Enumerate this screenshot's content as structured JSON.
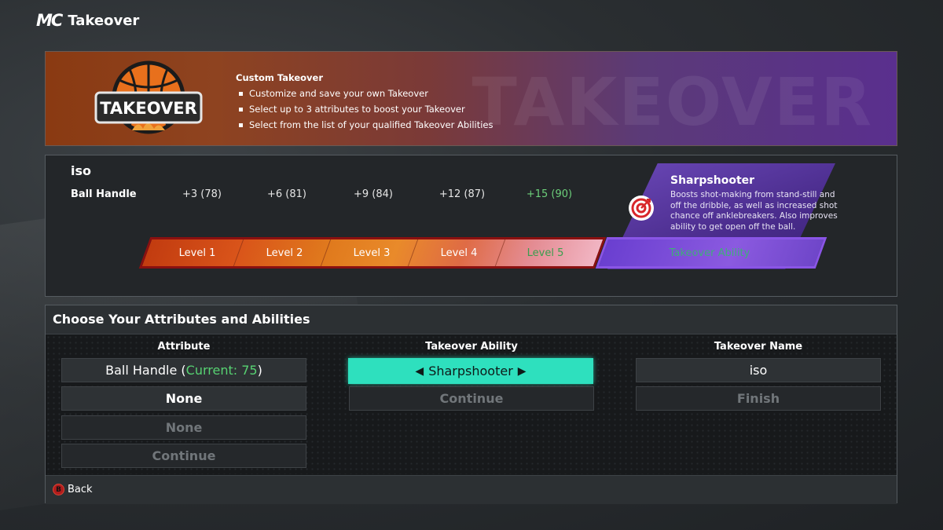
{
  "header": {
    "logo": "MC",
    "title": "Takeover"
  },
  "banner": {
    "watermark": "TAKEOVER",
    "logo_text": "TAKEOVER",
    "heading": "Custom Takeover",
    "bullets": [
      "Customize and save your own Takeover",
      "Select up to 3 attributes to boost your Takeover",
      "Select from the list of your qualified Takeover Abilities"
    ]
  },
  "takeover": {
    "name": "iso",
    "attribute": "Ball Handle",
    "boosts": [
      "+3 (78)",
      "+6 (81)",
      "+9 (84)",
      "+12 (87)",
      "+15 (90)"
    ],
    "levels": [
      "Level 1",
      "Level 2",
      "Level 3",
      "Level 4",
      "Level 5"
    ],
    "ability_bar_label": "Takeover Ability",
    "ability": {
      "title": "Sharpshooter",
      "description": "Boosts shot-making from stand-still and off the dribble, as well as increased shot chance off anklebreakers. Also improves ability to get open off the ball.",
      "icon": "target-icon"
    }
  },
  "choose": {
    "title": "Choose Your Attributes and Abilities",
    "columns": {
      "attribute": "Attribute",
      "ability": "Takeover Ability",
      "name": "Takeover Name"
    },
    "attribute_col": {
      "first_name": "Ball Handle",
      "current_label": "Current: 75",
      "second": "None",
      "third": "None",
      "continue": "Continue"
    },
    "ability_col": {
      "selected": "Sharpshooter",
      "continue": "Continue"
    },
    "name_col": {
      "value": "iso",
      "finish": "Finish"
    },
    "footer": {
      "back_button_glyph": "B",
      "back_label": "Back"
    }
  },
  "colors": {
    "accent_teal": "#2ee0be",
    "green_text": "#57d272",
    "ability_purple": "#6a3fd0",
    "level_orange": "#d9541a"
  }
}
